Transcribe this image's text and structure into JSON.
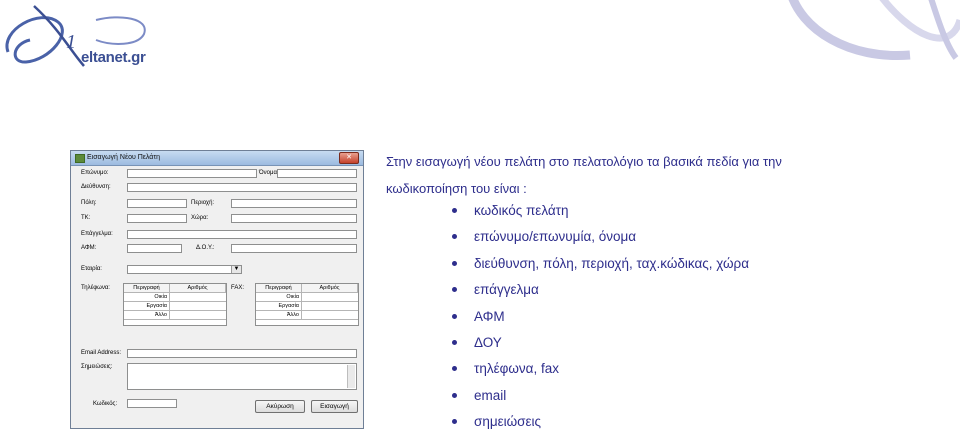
{
  "logo": {
    "text": "eltanet.gr"
  },
  "dialog": {
    "title": "Εισαγωγή Νέου Πελάτη",
    "close_glyph": "✕",
    "labels": {
      "surname": "Επώνυμο:",
      "name": "Όνομα:",
      "address": "Διεύθυνση:",
      "city": "Πόλη:",
      "area": "Περιοχή:",
      "tk": "ΤΚ:",
      "country": "Χώρα:",
      "profession": "Επάγγελμα:",
      "afm": "ΑΦΜ:",
      "doy": "Δ.Ο.Υ.:",
      "company": "Εταιρία:",
      "phones": "Τηλέφωνα:",
      "fax": "FAX:",
      "email": "Email Address:",
      "notes": "Σημειώσεις:",
      "code": "Κωδικός:"
    },
    "combo_arrow": "▼",
    "phones_grid": {
      "headers": [
        "Περιγραφή",
        "Αριθμός"
      ],
      "rows": [
        "Οικία",
        "Εργασία",
        "Άλλο"
      ]
    },
    "fax_grid": {
      "headers": [
        "Περιγραφή",
        "Αριθμός"
      ],
      "rows": [
        "Οικία",
        "Εργασία",
        "Άλλο"
      ]
    },
    "buttons": {
      "cancel": "Ακύρωση",
      "insert": "Εισαγωγή"
    }
  },
  "intro": "Στην εισαγωγή νέου πελάτη στο πελατολόγιο τα βασικά πεδία για την κωδικοποίηση του είναι :",
  "bullets": [
    "κωδικός πελάτη",
    "επώνυμο/επωνυμία, όνομα",
    "διεύθυνση, πόλη, περιοχή, ταχ.κώδικας, χώρα",
    "επάγγελμα",
    "ΑΦΜ",
    "ΔΟΥ",
    "τηλέφωνα, fax",
    "email",
    "σημειώσεις"
  ],
  "colors": {
    "text": "#2e2e8c",
    "logo": "#3b4f93",
    "deco": "#c9c9e4"
  }
}
